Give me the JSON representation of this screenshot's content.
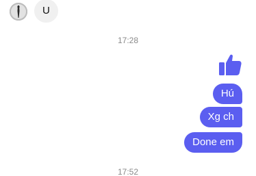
{
  "incoming": {
    "text": "U"
  },
  "timestamps": [
    "17:28",
    "17:52"
  ],
  "outgoing": {
    "like_icon": "thumbs-up-icon",
    "messages": [
      "Hú",
      "Xg ch",
      "Done em"
    ]
  },
  "colors": {
    "accent": "#5b5ef0",
    "incoming_bubble": "#f0f0f0",
    "timestamp": "#8a8a8a"
  }
}
